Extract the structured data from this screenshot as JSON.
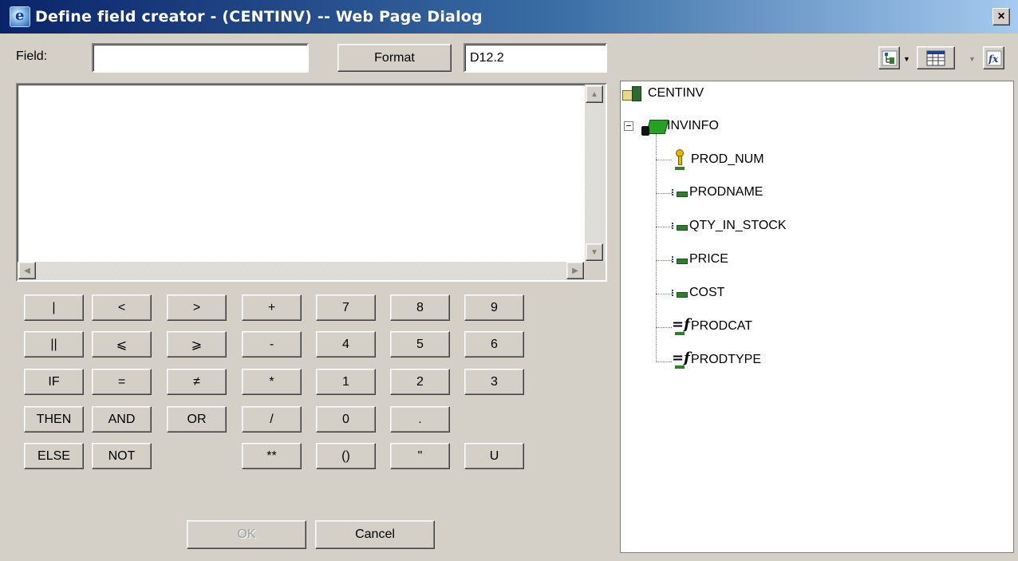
{
  "window": {
    "title": "Define field creator - (CENTINV) -- Web Page Dialog",
    "close_glyph": "×"
  },
  "form": {
    "field_label": "Field:",
    "field_value": "",
    "format_button": "Format",
    "format_value": "D12.2"
  },
  "keypad": {
    "row1": [
      "|",
      "<",
      ">",
      "+",
      "7",
      "8",
      "9"
    ],
    "row2": [
      "||",
      "⩽",
      "⩾",
      "-",
      "4",
      "5",
      "6"
    ],
    "row3": [
      "IF",
      "=",
      "≠",
      "*",
      "1",
      "2",
      "3"
    ],
    "row4": [
      "THEN",
      "AND",
      "OR",
      "/",
      "0",
      "."
    ],
    "row5": [
      "ELSE",
      "NOT",
      "**",
      "()",
      "\"",
      "U"
    ]
  },
  "buttons": {
    "ok": "OK",
    "cancel": "Cancel"
  },
  "toolbar": {
    "icons": [
      "tree-view-icon",
      "table-view-icon",
      "function-icon"
    ]
  },
  "tree": {
    "root": "CENTINV",
    "segment": "INVINFO",
    "segment_expander": "−",
    "fields": [
      {
        "name": "PROD_NUM",
        "icon": "key-field-icon"
      },
      {
        "name": "PRODNAME",
        "icon": "field-icon"
      },
      {
        "name": "QTY_IN_STOCK",
        "icon": "field-icon"
      },
      {
        "name": "PRICE",
        "icon": "field-icon"
      },
      {
        "name": "COST",
        "icon": "field-icon"
      },
      {
        "name": "PRODCAT",
        "icon": "computed-field-icon"
      },
      {
        "name": "PRODTYPE",
        "icon": "computed-field-icon"
      }
    ]
  }
}
